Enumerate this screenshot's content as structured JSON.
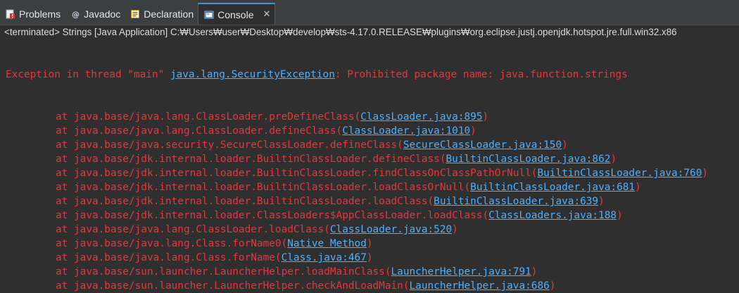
{
  "tabs": [
    {
      "label": "Problems",
      "icon": "problems-icon"
    },
    {
      "label": "Javadoc",
      "icon": "javadoc-icon"
    },
    {
      "label": "Declaration",
      "icon": "declaration-icon"
    },
    {
      "label": "Console",
      "icon": "console-icon",
      "active": true,
      "close": "✕"
    }
  ],
  "status_line": "<terminated> Strings [Java Application] C:₩Users₩user₩Desktop₩develop₩sts-4.17.0.RELEASE₩plugins₩org.eclipse.justj.openjdk.hotspot.jre.full.win32.x86",
  "exception": {
    "prefix": "Exception in thread \"main\" ",
    "type": "java.lang.SecurityException",
    "message": ": Prohibited package name: java.function.strings"
  },
  "stack": [
    {
      "method": "at java.base/java.lang.ClassLoader.preDefineClass(",
      "link": "ClassLoader.java:895",
      "suffix": ")"
    },
    {
      "method": "at java.base/java.lang.ClassLoader.defineClass(",
      "link": "ClassLoader.java:1010",
      "suffix": ")"
    },
    {
      "method": "at java.base/java.security.SecureClassLoader.defineClass(",
      "link": "SecureClassLoader.java:150",
      "suffix": ")"
    },
    {
      "method": "at java.base/jdk.internal.loader.BuiltinClassLoader.defineClass(",
      "link": "BuiltinClassLoader.java:862",
      "suffix": ")"
    },
    {
      "method": "at java.base/jdk.internal.loader.BuiltinClassLoader.findClassOnClassPathOrNull(",
      "link": "BuiltinClassLoader.java:760",
      "suffix": ")"
    },
    {
      "method": "at java.base/jdk.internal.loader.BuiltinClassLoader.loadClassOrNull(",
      "link": "BuiltinClassLoader.java:681",
      "suffix": ")"
    },
    {
      "method": "at java.base/jdk.internal.loader.BuiltinClassLoader.loadClass(",
      "link": "BuiltinClassLoader.java:639",
      "suffix": ")"
    },
    {
      "method": "at java.base/jdk.internal.loader.ClassLoaders$AppClassLoader.loadClass(",
      "link": "ClassLoaders.java:188",
      "suffix": ")"
    },
    {
      "method": "at java.base/java.lang.ClassLoader.loadClass(",
      "link": "ClassLoader.java:520",
      "suffix": ")"
    },
    {
      "method": "at java.base/java.lang.Class.forName0(",
      "link": "Native Method",
      "suffix": ")"
    },
    {
      "method": "at java.base/java.lang.Class.forName(",
      "link": "Class.java:467",
      "suffix": ")"
    },
    {
      "method": "at java.base/sun.launcher.LauncherHelper.loadMainClass(",
      "link": "LauncherHelper.java:791",
      "suffix": ")"
    },
    {
      "method": "at java.base/sun.launcher.LauncherHelper.checkAndLoadMain(",
      "link": "LauncherHelper.java:686",
      "suffix": ")"
    }
  ],
  "colors": {
    "error": "#e5373e",
    "link": "#4fb0ff",
    "background": "#2f2f2f",
    "active_tab_accent": "#4b8fd6"
  }
}
